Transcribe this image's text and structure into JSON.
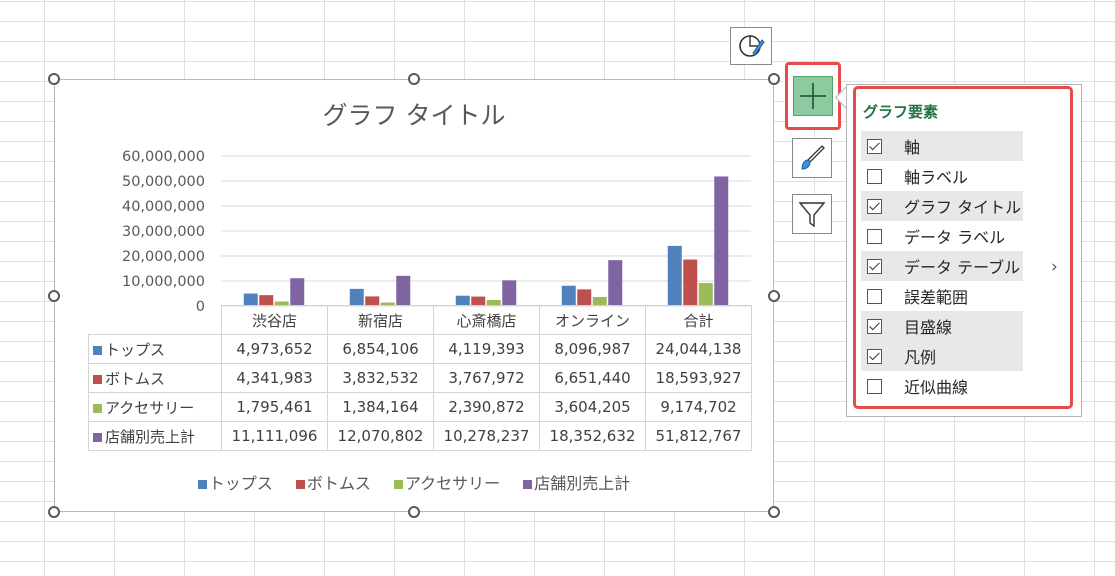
{
  "chart": {
    "title": "グラフ タイトル",
    "colors": {
      "tops": "#4f81bd",
      "bottoms": "#c0504d",
      "accessory": "#9bbb59",
      "total": "#8064a2"
    }
  },
  "chart_data": {
    "type": "bar",
    "title": "グラフ タイトル",
    "categories": [
      "渋谷店",
      "新宿店",
      "心斎橋店",
      "オンライン",
      "合計"
    ],
    "series": [
      {
        "name": "トップス",
        "values": [
          4973652,
          6854106,
          4119393,
          8096987,
          24044138
        ]
      },
      {
        "name": "ボトムス",
        "values": [
          4341983,
          3832532,
          3767972,
          6651440,
          18593927
        ]
      },
      {
        "name": "アクセサリー",
        "values": [
          1795461,
          1384164,
          2390872,
          3604205,
          9174702
        ]
      },
      {
        "name": "店舗別売上計",
        "values": [
          11111096,
          12070802,
          10278237,
          18352632,
          51812767
        ]
      }
    ],
    "ylim": [
      0,
      60000000
    ],
    "yticks": [
      "60,000,000",
      "50,000,000",
      "40,000,000",
      "30,000,000",
      "20,000,000",
      "10,000,000",
      "0"
    ],
    "grid": true,
    "legend": "bottom",
    "data_table": {
      "rows": [
        {
          "label": "トップス",
          "cells": [
            "4,973,652",
            "6,854,106",
            "4,119,393",
            "8,096,987",
            "24,044,138"
          ]
        },
        {
          "label": "ボトムス",
          "cells": [
            "4,341,983",
            "3,832,532",
            "3,767,972",
            "6,651,440",
            "18,593,927"
          ]
        },
        {
          "label": "アクセサリー",
          "cells": [
            "1,795,461",
            "1,384,164",
            "2,390,872",
            "3,604,205",
            "9,174,702"
          ]
        },
        {
          "label": "店舗別売上計",
          "cells": [
            "11,111,096",
            "12,070,802",
            "10,278,237",
            "18,352,632",
            "51,812,767"
          ]
        }
      ]
    }
  },
  "panel": {
    "title": "グラフ要素",
    "items": [
      {
        "label": "軸",
        "checked": true
      },
      {
        "label": "軸ラベル",
        "checked": false
      },
      {
        "label": "グラフ タイトル",
        "checked": true
      },
      {
        "label": "データ ラベル",
        "checked": false
      },
      {
        "label": "データ テーブル",
        "checked": true
      },
      {
        "label": "誤差範囲",
        "checked": false
      },
      {
        "label": "目盛線",
        "checked": true
      },
      {
        "label": "凡例",
        "checked": true
      },
      {
        "label": "近似曲線",
        "checked": false
      }
    ],
    "chevron": "›"
  },
  "icons": {
    "quick_layout": "chart-pie-brush-icon",
    "elements": "plus-icon",
    "styles": "paintbrush-icon",
    "filter": "funnel-icon"
  },
  "accent": {
    "highlight": "#e54b4b",
    "plus_bg": "#8ccba0",
    "panel_title": "#217346"
  }
}
